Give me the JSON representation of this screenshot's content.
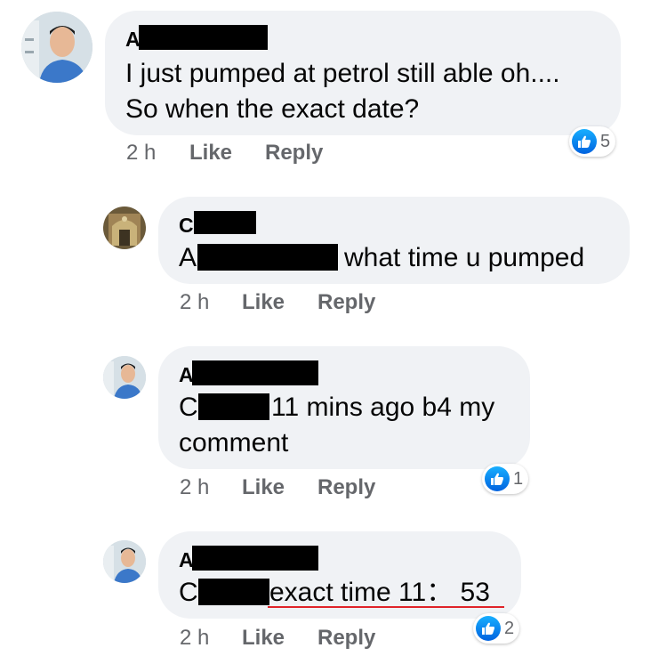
{
  "comments": [
    {
      "author_initial": "A",
      "lines": [
        "I just pumped at petrol still able oh....",
        "So when the exact date?"
      ],
      "time": "2 h",
      "like_label": "Like",
      "reply_label": "Reply",
      "reactions": "5"
    },
    {
      "author_initial": "C",
      "mention_initial": "A",
      "text": "what time u pumped",
      "time": "2 h",
      "like_label": "Like",
      "reply_label": "Reply"
    },
    {
      "author_initial": "A",
      "mention_initial": "C",
      "text_line1": "11 mins ago b4 my",
      "text_line2": "comment",
      "time": "2 h",
      "like_label": "Like",
      "reply_label": "Reply",
      "reactions": "1"
    },
    {
      "author_initial": "A",
      "mention_initial": "C",
      "text": "exact time 11： 53",
      "time": "2 h",
      "like_label": "Like",
      "reply_label": "Reply",
      "reactions": "2"
    }
  ],
  "colors": {
    "bubble": "#f0f2f5",
    "meta_text": "#65676b",
    "like_blue": "#1877f2",
    "underline": "#e0242a"
  },
  "icons": [
    "avatar-photo",
    "like-thumb-icon"
  ]
}
